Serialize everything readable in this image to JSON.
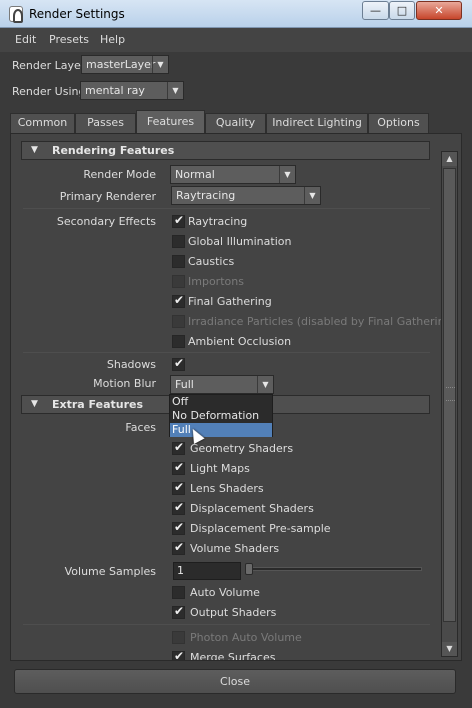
{
  "window": {
    "title": "Render Settings",
    "min_glyph": "—",
    "max_glyph": "□",
    "close_glyph": "✕"
  },
  "menu": {
    "items": [
      "Edit",
      "Presets",
      "Help"
    ]
  },
  "render_layer": {
    "label": "Render Layer",
    "value": "masterLayer"
  },
  "render_using": {
    "label": "Render Using",
    "value": "mental ray"
  },
  "tabs": [
    "Common",
    "Passes",
    "Features",
    "Quality",
    "Indirect Lighting",
    "Options"
  ],
  "active_tab": "Features",
  "rendering_features": {
    "header": "Rendering Features",
    "render_mode": {
      "label": "Render Mode",
      "value": "Normal"
    },
    "primary_renderer": {
      "label": "Primary Renderer",
      "value": "Raytracing"
    },
    "secondary_effects_label": "Secondary Effects",
    "secondary_effects": [
      {
        "label": "Raytracing",
        "checked": true,
        "enabled": true
      },
      {
        "label": "Global Illumination",
        "checked": false,
        "enabled": true
      },
      {
        "label": "Caustics",
        "checked": false,
        "enabled": true
      },
      {
        "label": "Importons",
        "checked": false,
        "enabled": false
      },
      {
        "label": "Final Gathering",
        "checked": true,
        "enabled": true
      },
      {
        "label": "Irradiance Particles (disabled by Final Gathering)",
        "checked": false,
        "enabled": false
      },
      {
        "label": "Ambient Occlusion",
        "checked": false,
        "enabled": true
      }
    ],
    "shadows": {
      "label": "Shadows",
      "checked": true
    },
    "motion_blur": {
      "label": "Motion Blur",
      "value": "Full",
      "options": [
        "Off",
        "No Deformation",
        "Full"
      ]
    }
  },
  "extra_features": {
    "header": "Extra Features",
    "faces_label": "Faces",
    "options": [
      {
        "label": "Geometry Shaders",
        "checked": true,
        "enabled": true
      },
      {
        "label": "Light Maps",
        "checked": true,
        "enabled": true
      },
      {
        "label": "Lens Shaders",
        "checked": true,
        "enabled": true
      },
      {
        "label": "Displacement Shaders",
        "checked": true,
        "enabled": true
      },
      {
        "label": "Displacement Pre-sample",
        "checked": true,
        "enabled": true
      },
      {
        "label": "Volume Shaders",
        "checked": true,
        "enabled": true
      }
    ],
    "volume_samples": {
      "label": "Volume Samples",
      "value": "1"
    },
    "more_options": [
      {
        "label": "Auto Volume",
        "checked": false,
        "enabled": true
      },
      {
        "label": "Output Shaders",
        "checked": true,
        "enabled": true
      }
    ],
    "bottom_options": [
      {
        "label": "Photon Auto Volume",
        "checked": false,
        "enabled": false
      },
      {
        "label": "Merge Surfaces",
        "checked": true,
        "enabled": true
      }
    ]
  },
  "footer": {
    "close_label": "Close"
  }
}
